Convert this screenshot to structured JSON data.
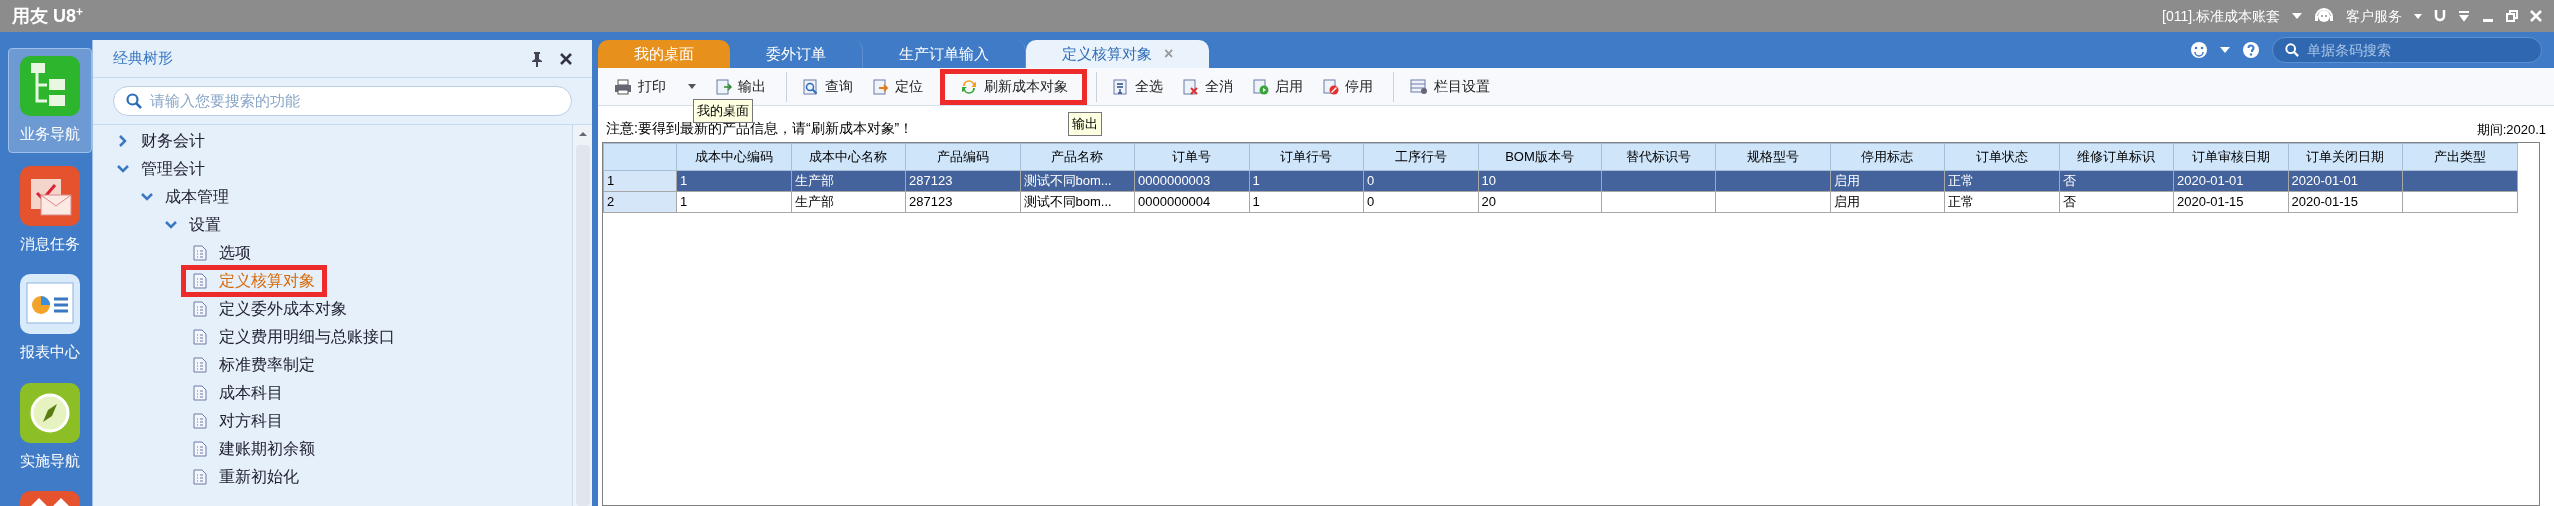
{
  "app": {
    "logo": "用友 U8",
    "logo_sup": "+",
    "account": "[011].标准成本账套",
    "service": "客户服务"
  },
  "nav": [
    {
      "label": "业务导航",
      "selected": true,
      "kind": "tree"
    },
    {
      "label": "消息任务",
      "selected": false,
      "kind": "mail"
    },
    {
      "label": "报表中心",
      "selected": false,
      "kind": "report"
    },
    {
      "label": "实施导航",
      "selected": false,
      "kind": "compass"
    },
    {
      "selected": false,
      "kind": "diamond"
    }
  ],
  "tree_panel": {
    "title": "经典树形",
    "search_placeholder": "请输入您要搜索的功能",
    "items": [
      {
        "label": "财务会计",
        "expanded": false
      },
      {
        "label": "管理会计",
        "expanded": true,
        "children": [
          {
            "label": "成本管理",
            "expanded": true,
            "children": [
              {
                "label": "设置",
                "expanded": true,
                "children": [
                  {
                    "label": "选项",
                    "selected": false,
                    "highlighted": false
                  },
                  {
                    "label": "定义核算对象",
                    "selected": true,
                    "highlighted": true
                  },
                  {
                    "label": "定义委外成本对象",
                    "selected": false,
                    "highlighted": false
                  },
                  {
                    "label": "定义费用明细与总账接口",
                    "selected": false,
                    "highlighted": false
                  },
                  {
                    "label": "标准费率制定",
                    "selected": false,
                    "highlighted": false
                  },
                  {
                    "label": "成本科目",
                    "selected": false,
                    "highlighted": false
                  },
                  {
                    "label": "对方科目",
                    "selected": false,
                    "highlighted": false
                  },
                  {
                    "label": "建账期初余额",
                    "selected": false,
                    "highlighted": false
                  },
                  {
                    "label": "重新初始化",
                    "selected": false,
                    "highlighted": false
                  }
                ]
              }
            ]
          }
        ]
      }
    ]
  },
  "tabs": [
    {
      "label": "我的桌面",
      "selected": false,
      "kind": "home"
    },
    {
      "label": "委外订单",
      "selected": false,
      "kind": "doc"
    },
    {
      "label": "生产订单输入",
      "selected": false,
      "kind": "doc"
    },
    {
      "label": "定义核算对象",
      "selected": true,
      "kind": "doc",
      "close": "×"
    }
  ],
  "barcode_search": {
    "placeholder": "单据条码搜索"
  },
  "toolbar": [
    {
      "label": "打印",
      "kind": "print",
      "dropdown": true,
      "highlighted": false,
      "group_start": false
    },
    {
      "label": "输出",
      "kind": "export",
      "dropdown": false,
      "highlighted": false,
      "group_start": false
    },
    {
      "label": "查询",
      "kind": "query",
      "dropdown": false,
      "highlighted": false,
      "group_start": true
    },
    {
      "label": "定位",
      "kind": "locate",
      "dropdown": false,
      "highlighted": false,
      "group_start": false
    },
    {
      "label": "刷新成本对象",
      "kind": "refresh",
      "dropdown": false,
      "highlighted": true,
      "group_start": true
    },
    {
      "label": "全选",
      "kind": "selectall",
      "dropdown": false,
      "highlighted": false,
      "group_start": true
    },
    {
      "label": "全消",
      "kind": "clearall",
      "dropdown": false,
      "highlighted": false,
      "group_start": false
    },
    {
      "label": "启用",
      "kind": "enable",
      "dropdown": false,
      "highlighted": false,
      "group_start": false
    },
    {
      "label": "停用",
      "kind": "disable",
      "dropdown": false,
      "highlighted": false,
      "group_start": false
    },
    {
      "label": "栏目设置",
      "kind": "columns",
      "dropdown": false,
      "highlighted": false,
      "group_start": true
    }
  ],
  "tooltips": [
    "我的桌面",
    "输出"
  ],
  "note": "注意:要得到最新的产品信息，请“刷新成本对象”！",
  "period": "期间:2020.1",
  "table": {
    "columns": [
      "",
      "成本中心编码",
      "成本中心名称",
      "产品编码",
      "产品名称",
      "订单号",
      "订单行号",
      "工序行号",
      "BOM版本号",
      "替代标识号",
      "规格型号",
      "停用标志",
      "订单状态",
      "维修订单标识",
      "订单审核日期",
      "订单关闭日期",
      "产出类型"
    ],
    "rows": [
      {
        "selected": true,
        "cells": [
          "1",
          "1",
          "生产部",
          "287123",
          "测试不同bom...",
          "0000000003",
          "1",
          "0",
          "10",
          "",
          "",
          "启用",
          "正常",
          "否",
          "2020-01-01",
          "2020-01-01",
          ""
        ]
      },
      {
        "selected": false,
        "cells": [
          "2",
          "1",
          "生产部",
          "287123",
          "测试不同bom...",
          "0000000004",
          "1",
          "0",
          "20",
          "",
          "",
          "启用",
          "正常",
          "否",
          "2020-01-15",
          "2020-01-15",
          ""
        ]
      }
    ]
  }
}
